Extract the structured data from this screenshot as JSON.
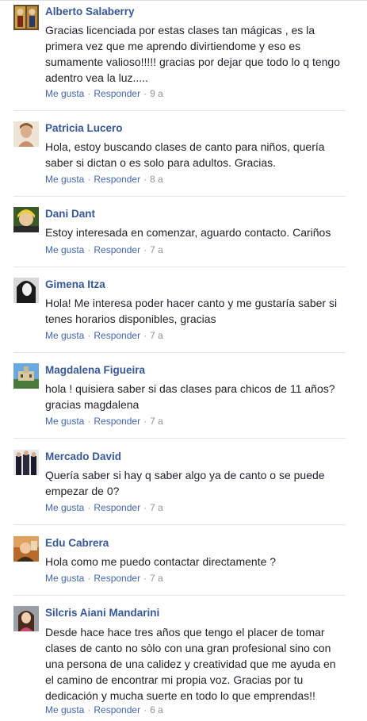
{
  "comments": [
    {
      "author": "Alberto Salaberry",
      "text": "Gracias licenciada por estas clases tan mágicas , es la\nprimera vez que me aprendo divirtiendome y eso es\nsumamente valioso!!!!! gracias por dejar que todo lo q tengo\nadentro vea la luz.....",
      "like": "Me gusta",
      "reply": "Responder",
      "age": "9 a"
    },
    {
      "author": "Patricia Lucero",
      "text": "Hola, estoy buscando clases de canto para niños, quería\nsaber si dictan o es solo para adultos. Gracias.",
      "like": "Me gusta",
      "reply": "Responder",
      "age": "8 a"
    },
    {
      "author": "Dani Dant",
      "text": "Estoy interesada en comenzar, aguardo contacto. Cariños",
      "like": "Me gusta",
      "reply": "Responder",
      "age": "7 a"
    },
    {
      "author": "Gimena Itza",
      "text": "Hola! Me interesa poder hacer canto y me gustaría saber si\ntenes horarios disponibles, gracias",
      "like": "Me gusta",
      "reply": "Responder",
      "age": "7 a"
    },
    {
      "author": "Magdalena Figueira",
      "text": "hola ! quisiera saber si das clases para chicos de 11 años?\ngracias magdalena",
      "like": "Me gusta",
      "reply": "Responder",
      "age": "7 a"
    },
    {
      "author": "Mercado David",
      "text": "Quería saber si hay q saber algo ya de canto o se puede\nempezar de 0?",
      "like": "Me gusta",
      "reply": "Responder",
      "age": "7 a"
    },
    {
      "author": "Edu Cabrera",
      "text": "Hola como me puedo contactar directamente ?",
      "like": "Me gusta",
      "reply": "Responder",
      "age": "7 a"
    },
    {
      "author": "Silcris Aiani Mandarini",
      "text": "Desde hace hace tres años que tengo el placer de tomar\nclases de canto no sòlo con una gran profesional sino con\nuna persona de una calidez y creatividad que me ayuda en\nel camino de encontrar mi propia voz. Gracias por tu\ndedicación y mucha suerte en todo lo que emprendas!!",
      "like": "Me gusta",
      "reply": "Responder",
      "age": "6 a"
    }
  ],
  "separator": "·"
}
